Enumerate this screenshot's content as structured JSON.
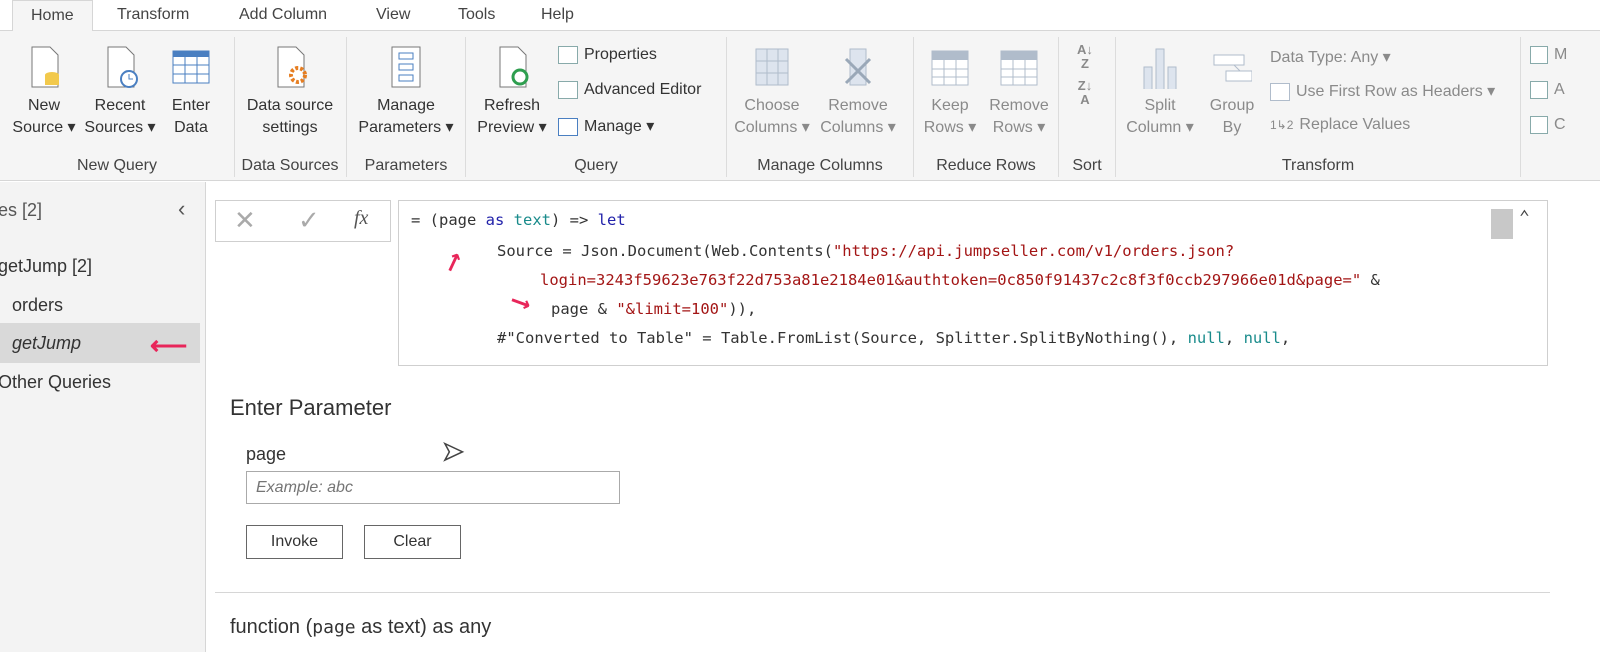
{
  "tabs": [
    "Home",
    "Transform",
    "Add Column",
    "View",
    "Tools",
    "Help"
  ],
  "ribbon": {
    "new_query": {
      "label": "New Query",
      "new_source": [
        "New",
        "Source ▾"
      ],
      "recent_sources": [
        "Recent",
        "Sources ▾"
      ],
      "enter_data": [
        "Enter",
        "Data"
      ]
    },
    "data_sources": {
      "label": "Data Sources",
      "settings": [
        "Data source",
        "settings"
      ]
    },
    "parameters": {
      "label": "Parameters",
      "manage": [
        "Manage",
        "Parameters ▾"
      ]
    },
    "query": {
      "label": "Query",
      "refresh": [
        "Refresh",
        "Preview ▾"
      ],
      "properties": "Properties",
      "advanced_editor": "Advanced Editor",
      "manage": "Manage ▾"
    },
    "manage_columns": {
      "label": "Manage Columns",
      "choose": [
        "Choose",
        "Columns ▾"
      ],
      "remove": [
        "Remove",
        "Columns ▾"
      ]
    },
    "reduce_rows": {
      "label": "Reduce Rows",
      "keep": [
        "Keep",
        "Rows ▾"
      ],
      "remove": [
        "Remove",
        "Rows ▾"
      ]
    },
    "sort": {
      "label": "Sort"
    },
    "transform": {
      "label": "Transform",
      "split": [
        "Split",
        "Column ▾"
      ],
      "group": [
        "Group",
        "By"
      ],
      "data_type": "Data Type: Any ▾",
      "first_row": "Use First Row as Headers ▾",
      "replace": "Replace Values"
    },
    "cut_off": [
      "M",
      "A",
      "C"
    ]
  },
  "queries": {
    "header": "es [2]",
    "items": [
      "getJump [2]",
      "orders",
      "getJump",
      "Other Queries"
    ]
  },
  "formula": {
    "fx": "fx",
    "lines": {
      "l1a": "= (page ",
      "l1b": "as ",
      "l1c": "text",
      ") => ": "",
      "l1d": ") => ",
      "l1e": "let",
      "l2a": "Source = Json.Document(Web.Contents(",
      "l2b": "\"https://api.jumpseller.com/v1/orders.json?",
      "l3a": "login=3243f59623e763f22d753a81e2184e01&authtoken=0c850f91437c2c8f3f0ccb297966e01d&page=\"",
      "l3b": " &",
      "l4a": "page & ",
      "l4b": "\"&limit=100\"",
      "l4c": ")),",
      "l5a": "#\"Converted to Table\" = Table.FromList(Source, Splitter.SplitByNothing(), ",
      "l5b": "null",
      ", ": "",
      "l5c": ", ",
      "l5d": "null",
      "l5e": ","
    }
  },
  "parameter": {
    "title": "Enter Parameter",
    "label": "page",
    "placeholder": "Example: abc",
    "invoke": "Invoke",
    "clear": "Clear"
  },
  "signature": {
    "a": "function (",
    "b": "page",
    "c": " as text) as any"
  }
}
